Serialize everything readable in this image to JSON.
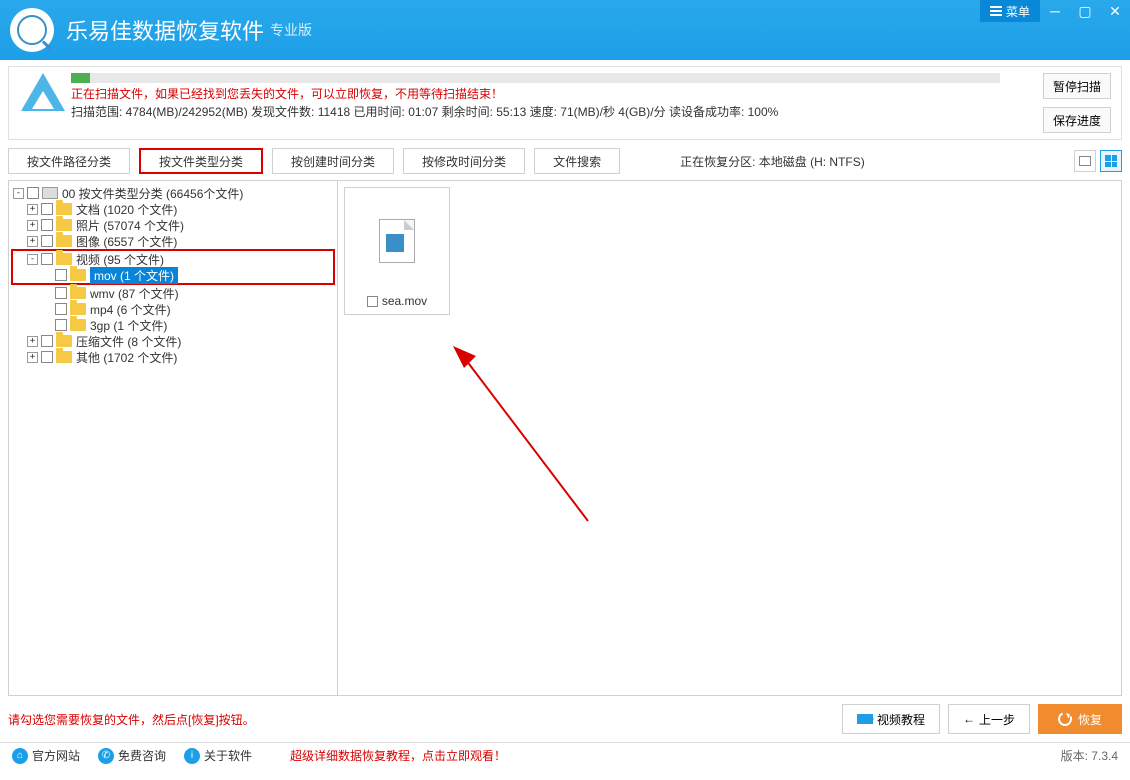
{
  "titlebar": {
    "title": "乐易佳数据恢复软件",
    "subtitle": "专业版",
    "menu_label": "菜单"
  },
  "status": {
    "progress_percent": 2,
    "message_red": "正在扫描文件，如果已经找到您丢失的文件，可以立即恢复，不用等待扫描结束！",
    "info_line": "扫描范围: 4784(MB)/242952(MB)   发现文件数: 11418    已用时间: 01:07    剩余时间: 55:13    速度: 71(MB)/秒  4(GB)/分  读设备成功率: 100%",
    "pause_label": "暂停扫描",
    "save_label": "保存进度"
  },
  "tabs": {
    "items": [
      {
        "label": "按文件路径分类"
      },
      {
        "label": "按文件类型分类"
      },
      {
        "label": "按创建时间分类"
      },
      {
        "label": "按修改时间分类"
      },
      {
        "label": "文件搜索"
      }
    ],
    "info": "正在恢复分区: 本地磁盘 (H: NTFS)"
  },
  "tree": {
    "root": "00 按文件类型分类    (66456个文件)",
    "doc": "文档    (1020 个文件)",
    "photo": "照片    (57074 个文件)",
    "image": "图像    (6557 个文件)",
    "video": "视频    (95 个文件)",
    "mov": "mov    (1 个文件)",
    "wmv": "wmv    (87 个文件)",
    "mp4": "mp4    (6 个文件)",
    "gp3": "3gp    (1 个文件)",
    "zip": "压缩文件    (8 个文件)",
    "other": "其他    (1702 个文件)"
  },
  "content": {
    "file1": "sea.mov"
  },
  "hint": {
    "text": "请勾选您需要恢复的文件，然后点[恢复]按钮。",
    "video_tutorial": "视频教程",
    "prev": "上一步",
    "recover": "恢复"
  },
  "footer": {
    "official": "官方网站",
    "consult": "免费咨询",
    "about": "关于软件",
    "tutorial": "超级详细数据恢复教程，点击立即观看！",
    "version": "版本: 7.3.4"
  }
}
